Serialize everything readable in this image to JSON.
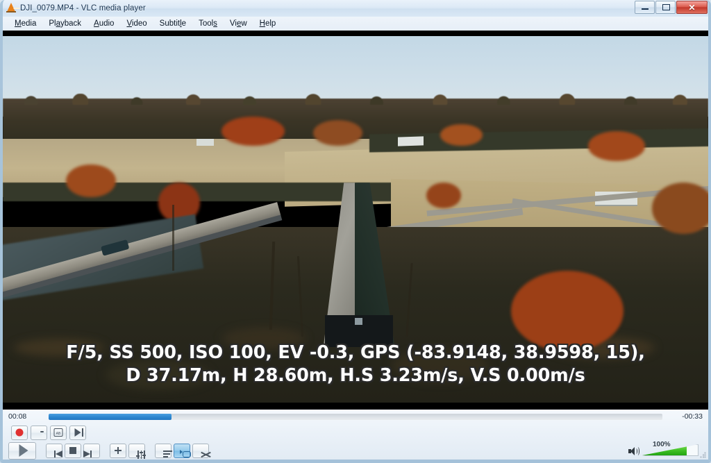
{
  "window": {
    "title": "DJI_0079.MP4 - VLC media player",
    "app_icon": "vlc-cone-icon",
    "buttons": {
      "minimize": "minimize-icon",
      "maximize": "maximize-icon",
      "close": "✕"
    }
  },
  "menubar": {
    "items": [
      {
        "pre": "",
        "accel": "M",
        "post": "edia"
      },
      {
        "pre": "Pl",
        "accel": "a",
        "post": "yback"
      },
      {
        "pre": "",
        "accel": "A",
        "post": "udio"
      },
      {
        "pre": "",
        "accel": "V",
        "post": "ideo"
      },
      {
        "pre": "Subtit",
        "accel": "l",
        "post": "e"
      },
      {
        "pre": "Tool",
        "accel": "s",
        "post": ""
      },
      {
        "pre": "Vi",
        "accel": "e",
        "post": "w"
      },
      {
        "pre": "",
        "accel": "H",
        "post": "elp"
      }
    ]
  },
  "video": {
    "osd_overlay": "F/5, SS 500, ISO 100, EV -0.3, GPS (-83.9148, 38.9598, 15), D 37.17m, H 28.60m, H.S 3.23m/s, V.S 0.00m/s",
    "scene_description": "Aerial autumn drone footage of a dark covered bridge beside a modern road bridge over a river, farm fields and red-orange trees",
    "colors": {
      "sky": "#c9dbe7",
      "field": "#bdae86",
      "foliage_orange": "#a8461c",
      "foliage_red": "#8c2f18",
      "woods_dark": "#2b2a1e",
      "bridge_roof_dark": "#223029",
      "bridge_roof_light": "#9b9a92"
    }
  },
  "controls": {
    "time_elapsed": "00:08",
    "time_remaining": "-00:33",
    "progress_percent": 20,
    "accent_color": "#2b86cf",
    "top_buttons": [
      {
        "name": "record-button",
        "icon": "record-icon"
      },
      {
        "name": "snapshot-button",
        "icon": "camera-icon"
      },
      {
        "name": "ab-loop-button",
        "icon": "ab-loop-icon",
        "label": "AB"
      },
      {
        "name": "frame-by-frame-button",
        "icon": "frame-step-icon"
      }
    ],
    "transport": [
      {
        "name": "play-button",
        "icon": "play-icon"
      },
      {
        "name": "previous-button",
        "icon": "previous-icon"
      },
      {
        "name": "stop-button",
        "icon": "stop-icon"
      },
      {
        "name": "next-button",
        "icon": "next-icon"
      },
      {
        "name": "fullscreen-button",
        "icon": "fullscreen-icon"
      },
      {
        "name": "extended-settings-button",
        "icon": "equalizer-icon"
      },
      {
        "name": "playlist-button",
        "icon": "playlist-icon"
      },
      {
        "name": "loop-button",
        "icon": "loop-icon",
        "active": true
      },
      {
        "name": "shuffle-button",
        "icon": "shuffle-icon"
      }
    ],
    "volume": {
      "label": "100%",
      "level": 100,
      "icon": "speaker-icon",
      "fill_color": "#3fbf25"
    }
  }
}
